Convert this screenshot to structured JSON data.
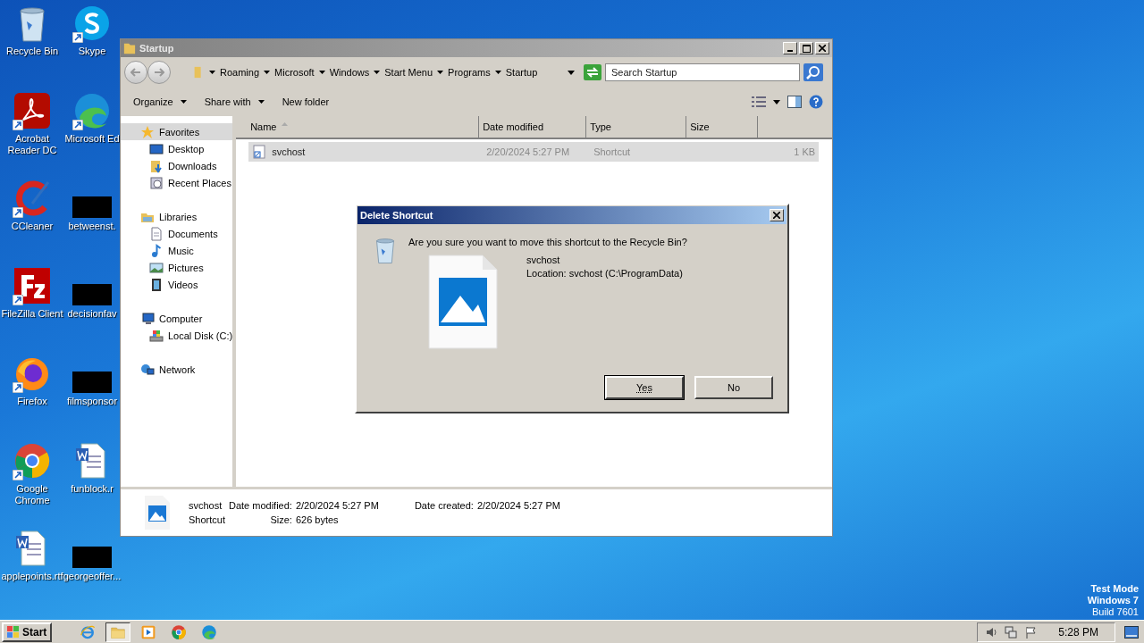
{
  "desktop": {
    "icons": [
      {
        "label": "Recycle Bin",
        "kind": "recyclebin",
        "shortcut": false
      },
      {
        "label": "Acrobat Reader DC",
        "kind": "acrobat",
        "shortcut": true
      },
      {
        "label": "CCleaner",
        "kind": "ccleaner",
        "shortcut": true
      },
      {
        "label": "FileZilla Client",
        "kind": "filezilla",
        "shortcut": true
      },
      {
        "label": "Firefox",
        "kind": "firefox",
        "shortcut": true
      },
      {
        "label": "Google Chrome",
        "kind": "chrome",
        "shortcut": true
      },
      {
        "label": "applepoints.rtf",
        "kind": "word",
        "shortcut": false
      },
      {
        "label": "Skype",
        "kind": "skype",
        "shortcut": true
      },
      {
        "label": "Microsoft Ed",
        "kind": "edge",
        "shortcut": true
      },
      {
        "label": "betweenst.",
        "kind": "redacted",
        "shortcut": false
      },
      {
        "label": "decisionfav",
        "kind": "redacted",
        "shortcut": false
      },
      {
        "label": "filmsponsor",
        "kind": "redacted",
        "shortcut": false
      },
      {
        "label": "funblock.r",
        "kind": "word",
        "shortcut": false
      },
      {
        "label": "georgeoffer...",
        "kind": "redacted",
        "shortcut": false
      }
    ],
    "watermark_lines": [
      "Test Mode",
      "Windows 7",
      "Build 7601"
    ]
  },
  "explorer": {
    "title": "Startup",
    "breadcrumb": [
      "Roaming",
      "Microsoft",
      "Windows",
      "Start Menu",
      "Programs",
      "Startup"
    ],
    "search": {
      "placeholder": "Search Startup"
    },
    "toolbar": [
      {
        "label": "Organize",
        "dropdown": true
      },
      {
        "label": "Share with",
        "dropdown": true
      },
      {
        "label": "New folder",
        "dropdown": false
      }
    ],
    "sidebar": [
      {
        "label": "Favorites",
        "kind": "star",
        "selected": true,
        "children": [
          {
            "label": "Desktop",
            "kind": "desktop",
            "selected": false
          },
          {
            "label": "Downloads",
            "kind": "downloads",
            "selected": false
          },
          {
            "label": "Recent Places",
            "kind": "recent",
            "selected": false
          }
        ]
      },
      {
        "label": "Libraries",
        "kind": "libraries",
        "selected": false,
        "children": [
          {
            "label": "Documents",
            "kind": "documents",
            "selected": false
          },
          {
            "label": "Music",
            "kind": "music",
            "selected": false
          },
          {
            "label": "Pictures",
            "kind": "pictures",
            "selected": false
          },
          {
            "label": "Videos",
            "kind": "videos",
            "selected": false
          }
        ]
      },
      {
        "label": "Computer",
        "kind": "computer",
        "selected": false,
        "children": [
          {
            "label": "Local Disk (C:)",
            "kind": "disk",
            "selected": false
          }
        ]
      },
      {
        "label": "Network",
        "kind": "network",
        "selected": false
      }
    ],
    "columns": [
      {
        "label": "Name",
        "sorted": true
      },
      {
        "label": "Date modified",
        "sorted": false
      },
      {
        "label": "Type",
        "sorted": false
      },
      {
        "label": "Size",
        "sorted": false
      }
    ],
    "rows": [
      {
        "name": "svchost",
        "date_modified": "2/20/2024 5:27 PM",
        "type": "Shortcut",
        "size": "1 KB",
        "selected": true
      }
    ],
    "details": {
      "name": "svchost",
      "type": "Shortcut",
      "fields": [
        {
          "label": "Date modified:",
          "value": "2/20/2024 5:27 PM"
        },
        {
          "label": "Size:",
          "value": "626 bytes"
        },
        {
          "label": "Date created:",
          "value": "2/20/2024 5:27 PM"
        }
      ]
    }
  },
  "dialog": {
    "title": "Delete Shortcut",
    "question": "Are you sure you want to move this shortcut to the Recycle Bin?",
    "file_name": "svchost",
    "location": "Location: svchost (C:\\ProgramData)",
    "buttons": [
      {
        "label": "Yes",
        "selected": true
      },
      {
        "label": "No",
        "selected": false
      }
    ]
  },
  "taskbar": {
    "start": "Start",
    "apps": [
      {
        "kind": "ie",
        "selected": false
      },
      {
        "kind": "explorer",
        "selected": true
      },
      {
        "kind": "media",
        "selected": false
      },
      {
        "kind": "chrome",
        "selected": false
      },
      {
        "kind": "edge",
        "selected": false
      }
    ],
    "clock": "5:28 PM"
  }
}
